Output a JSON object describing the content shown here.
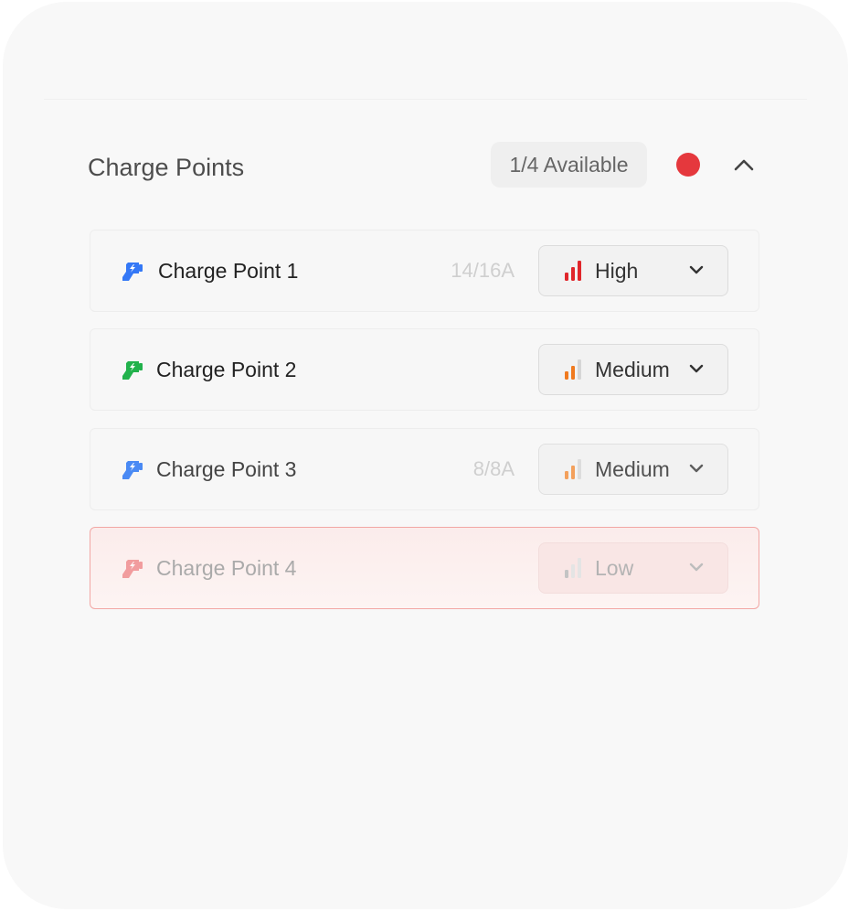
{
  "header": {
    "title": "Charge Points",
    "availability": "1/4 Available",
    "status_color": "#e5383d",
    "collapse_icon": "chevron-up-icon"
  },
  "charge_points": [
    {
      "name": "Charge Point 1",
      "current": "14/16A",
      "priority": "High",
      "icon_color": "#3478f6",
      "priority_color": "#e0262b",
      "signal_level": 3
    },
    {
      "name": "Charge Point 2",
      "current": "",
      "priority": "Medium",
      "icon_color": "#22b24c",
      "priority_color": "#f07a1f",
      "signal_level": 2
    },
    {
      "name": "Charge Point 3",
      "current": "8/8A",
      "priority": "Medium",
      "icon_color": "#4a8af4",
      "priority_color": "#f07a1f",
      "signal_level": 2
    },
    {
      "name": "Charge Point 4",
      "current": "",
      "priority": "Low",
      "icon_color": "#e5383d",
      "priority_color": "#cccccc",
      "signal_level": 1,
      "status": "fault"
    }
  ]
}
